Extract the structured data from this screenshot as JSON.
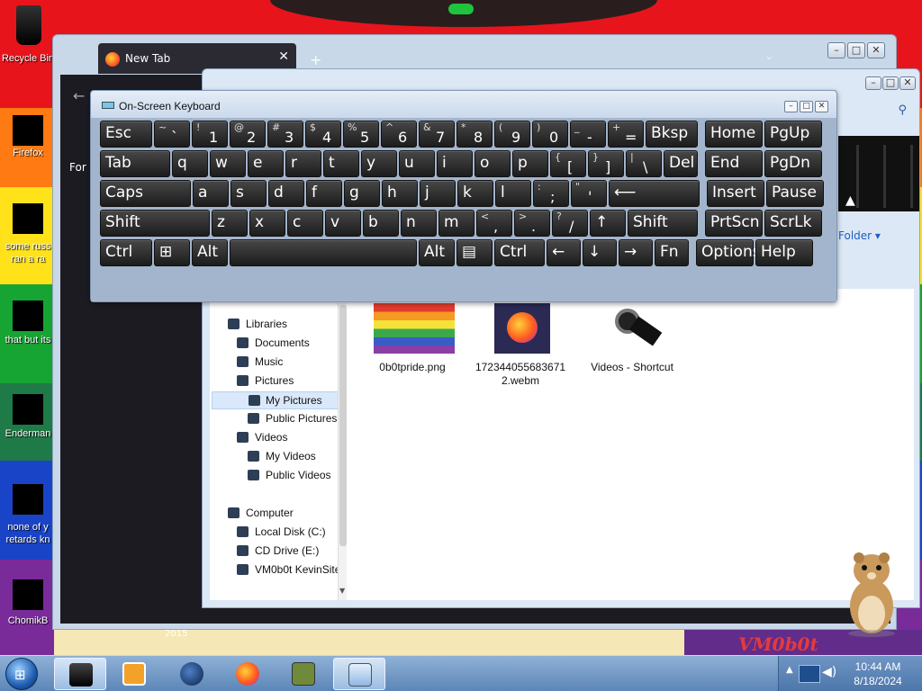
{
  "desktop": {
    "wallpaper_text": "VM0b0t",
    "wallpaper_year": "2015",
    "icons": [
      {
        "label": "Recycle Bin",
        "icon": "recycle-bin-icon"
      },
      {
        "label": "Firefox",
        "icon": "firefox-icon"
      },
      {
        "label": "some russ ran a ra",
        "icon": "file-icon"
      },
      {
        "label": "that but its",
        "icon": "file-icon"
      },
      {
        "label": "Enderman",
        "icon": "file-icon"
      },
      {
        "label": "none of y retards kn",
        "icon": "file-icon"
      },
      {
        "label": "ChomikB",
        "icon": "file-icon"
      }
    ]
  },
  "browser": {
    "tab_title": "New Tab",
    "tab_close": "✕",
    "new_tab": "+",
    "content_text": "For c"
  },
  "explorer": {
    "folder_link": "Folder",
    "nav": [
      {
        "label": "Libraries",
        "icon": "libraries-icon",
        "level": 0
      },
      {
        "label": "Documents",
        "icon": "documents-icon",
        "level": 1
      },
      {
        "label": "Music",
        "icon": "music-icon",
        "level": 1
      },
      {
        "label": "Pictures",
        "icon": "pictures-icon",
        "level": 1
      },
      {
        "label": "My Pictures",
        "icon": "folder-icon",
        "level": 2,
        "selected": true
      },
      {
        "label": "Public Pictures",
        "icon": "folder-icon",
        "level": 2
      },
      {
        "label": "Videos",
        "icon": "videos-icon",
        "level": 1
      },
      {
        "label": "My Videos",
        "icon": "folder-icon",
        "level": 2
      },
      {
        "label": "Public Videos",
        "icon": "folder-icon",
        "level": 2
      },
      {
        "label": "Computer",
        "icon": "computer-icon",
        "level": 0
      },
      {
        "label": "Local Disk (C:)",
        "icon": "disk-icon",
        "level": 1
      },
      {
        "label": "CD Drive (E:)",
        "icon": "cd-drive-icon",
        "level": 1
      },
      {
        "label": "VM0b0t KevinSite",
        "icon": "network-drive-icon",
        "level": 1
      }
    ],
    "files": [
      {
        "name": "0b0tpride.png",
        "icon": "image-thumbnail-icon"
      },
      {
        "name": "172344055683671 2.webm",
        "icon": "firefox-file-icon"
      },
      {
        "name": "Videos - Shortcut",
        "icon": "film-reel-icon"
      }
    ]
  },
  "osk": {
    "title": "On-Screen Keyboard",
    "rows": [
      [
        {
          "label": "Esc"
        },
        {
          "shift": "~",
          "main": "`"
        },
        {
          "shift": "!",
          "main": "1"
        },
        {
          "shift": "@",
          "main": "2"
        },
        {
          "shift": "#",
          "main": "3"
        },
        {
          "shift": "$",
          "main": "4"
        },
        {
          "shift": "%",
          "main": "5"
        },
        {
          "shift": "^",
          "main": "6"
        },
        {
          "shift": "&",
          "main": "7"
        },
        {
          "shift": "*",
          "main": "8"
        },
        {
          "shift": "(",
          "main": "9"
        },
        {
          "shift": ")",
          "main": "0"
        },
        {
          "shift": "_",
          "main": "-"
        },
        {
          "shift": "+",
          "main": "="
        },
        {
          "label": "Bksp"
        },
        {
          "label": "Home"
        },
        {
          "label": "PgUp"
        }
      ],
      [
        {
          "label": "Tab"
        },
        {
          "label": "q"
        },
        {
          "label": "w"
        },
        {
          "label": "e"
        },
        {
          "label": "r"
        },
        {
          "label": "t"
        },
        {
          "label": "y"
        },
        {
          "label": "u"
        },
        {
          "label": "i"
        },
        {
          "label": "o"
        },
        {
          "label": "p"
        },
        {
          "shift": "{",
          "main": "["
        },
        {
          "shift": "}",
          "main": "]"
        },
        {
          "shift": "|",
          "main": "\\"
        },
        {
          "label": "Del"
        },
        {
          "label": "End"
        },
        {
          "label": "PgDn"
        }
      ],
      [
        {
          "label": "Caps"
        },
        {
          "label": "a"
        },
        {
          "label": "s"
        },
        {
          "label": "d"
        },
        {
          "label": "f"
        },
        {
          "label": "g"
        },
        {
          "label": "h"
        },
        {
          "label": "j"
        },
        {
          "label": "k"
        },
        {
          "label": "l"
        },
        {
          "shift": ":",
          "main": ";"
        },
        {
          "shift": "\"",
          "main": "'"
        },
        {
          "label": "⟵"
        },
        {
          "label": "Insert"
        },
        {
          "label": "Pause"
        }
      ],
      [
        {
          "label": "Shift"
        },
        {
          "label": "z"
        },
        {
          "label": "x"
        },
        {
          "label": "c"
        },
        {
          "label": "v"
        },
        {
          "label": "b"
        },
        {
          "label": "n"
        },
        {
          "label": "m"
        },
        {
          "shift": "<",
          "main": ","
        },
        {
          "shift": ">",
          "main": "."
        },
        {
          "shift": "?",
          "main": "/"
        },
        {
          "label": "↑"
        },
        {
          "label": "Shift"
        },
        {
          "label": "PrtScn"
        },
        {
          "label": "ScrLk"
        }
      ],
      [
        {
          "label": "Ctrl"
        },
        {
          "label": "⊞"
        },
        {
          "label": "Alt"
        },
        {
          "label": ""
        },
        {
          "label": "Alt"
        },
        {
          "label": "▤"
        },
        {
          "label": "Ctrl"
        },
        {
          "label": "←"
        },
        {
          "label": "↓"
        },
        {
          "label": "→"
        },
        {
          "label": "Fn"
        },
        {
          "label": "Options"
        },
        {
          "label": "Help"
        }
      ]
    ]
  },
  "taskbar": {
    "items": [
      {
        "icon": "explorer-icon",
        "active": true
      },
      {
        "icon": "media-player-icon",
        "active": false
      },
      {
        "icon": "globe-icon",
        "active": false
      },
      {
        "icon": "firefox-icon",
        "active": false
      },
      {
        "icon": "hamster-box-icon",
        "active": false
      },
      {
        "icon": "on-screen-keyboard-icon",
        "active": true
      }
    ],
    "time": "10:44 AM",
    "date": "8/18/2024"
  }
}
